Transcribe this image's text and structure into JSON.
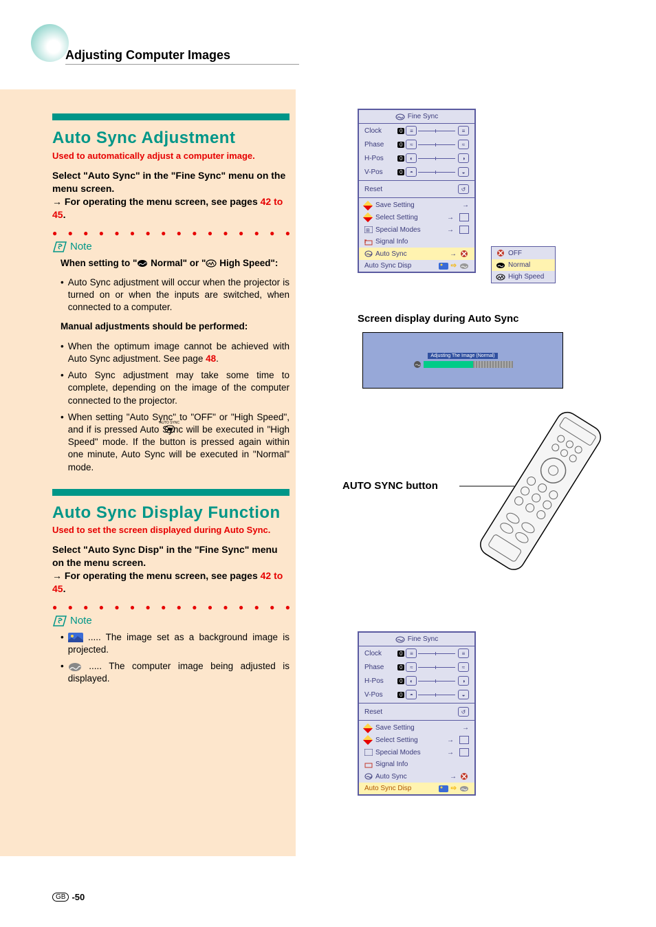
{
  "header": {
    "title": "Adjusting Computer Images"
  },
  "section1": {
    "heading": "Auto Sync Adjustment",
    "subhead": "Used to automatically adjust a computer image.",
    "intro_line1": "Select \"Auto Sync\" in the \"Fine Sync\" menu on the menu screen.",
    "intro_line2_pre": "→ For operating the menu screen, see pages ",
    "intro_line2_link": "42 to 45",
    "intro_line2_post": "."
  },
  "note1": {
    "label": "Note",
    "heading_pre": "When setting to \"",
    "heading_mid": " Normal\" or \"",
    "heading_post": " High Speed\":",
    "bullet1": "Auto Sync adjustment will occur when the projector is turned on or when the inputs are switched, when connected to a computer.",
    "heading2": "Manual adjustments should be performed:",
    "bullet2_pre": "When the optimum image cannot be achieved with Auto Sync adjustment. See page ",
    "bullet2_link": "48",
    "bullet2_post": ".",
    "bullet3": "Auto Sync adjustment may take some time to complete, depending on the image of the computer connected to the projector.",
    "bullet4": "When setting \"Auto Sync\" to \"OFF\" or \"High Speed\", and if       is pressed Auto Sync will be executed in \"High Speed\" mode. If the button is pressed again within one minute, Auto Sync will be executed in \"Normal\" mode.",
    "autosync_small": "AUTO SYNC"
  },
  "section2": {
    "heading": "Auto Sync Display Function",
    "subhead": "Used to set the screen displayed during Auto Sync.",
    "intro_line1": "Select \"Auto Sync Disp\" in the \"Fine Sync\" menu on the menu screen.",
    "intro_line2_pre": "→ For operating the menu screen, see pages ",
    "intro_line2_link": "42 to 45",
    "intro_line2_post": "."
  },
  "note2": {
    "label": "Note",
    "item1": "..... The image set as a background image is projected.",
    "item2": "..... The computer image being adjusted is displayed."
  },
  "menu": {
    "title": "Fine Sync",
    "rows": {
      "clock": "Clock",
      "phase": "Phase",
      "hpos": "H-Pos",
      "vpos": "V-Pos",
      "reset": "Reset",
      "save": "Save Setting",
      "select": "Select Setting",
      "special": "Special Modes",
      "signal": "Signal Info",
      "autosync": "Auto Sync",
      "autosyncdisp": "Auto Sync Disp"
    },
    "zero": "0"
  },
  "popup": {
    "off": "OFF",
    "normal": "Normal",
    "high": "High Speed"
  },
  "right": {
    "caption1": "Screen display during Auto Sync",
    "adj_label": "Adjusting The Image (Normal)",
    "caption2": "AUTO SYNC button"
  },
  "footer": {
    "gb": "GB",
    "page": "-50"
  }
}
